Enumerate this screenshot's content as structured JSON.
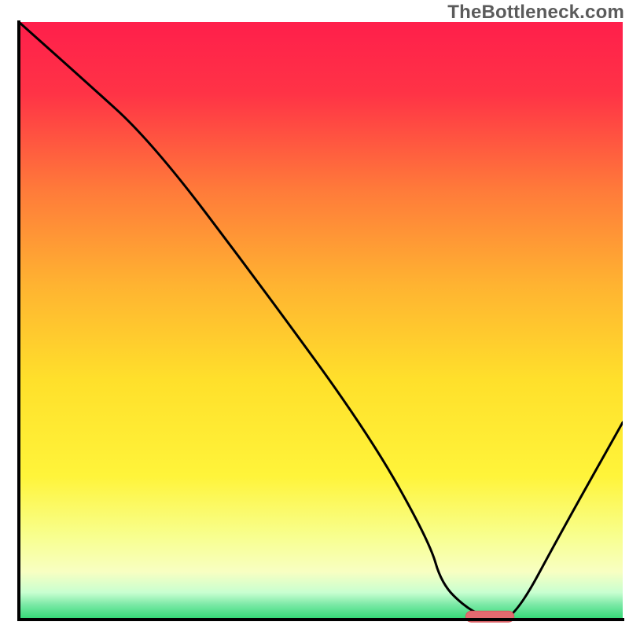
{
  "watermark": {
    "text": "TheBottleneck.com"
  },
  "colors": {
    "axis": "#000000",
    "curve": "#000000",
    "marker_fill": "#e46a6f",
    "marker_stroke": "#d85a60"
  },
  "chart_data": {
    "type": "line",
    "title": "",
    "xlabel": "",
    "ylabel": "",
    "xlim": [
      0,
      100
    ],
    "ylim": [
      0,
      100
    ],
    "grid": false,
    "legend": false,
    "background_gradient": {
      "direction": "vertical",
      "stops": [
        {
          "pos": 0.0,
          "color": "#ff1f4b"
        },
        {
          "pos": 0.12,
          "color": "#ff3346"
        },
        {
          "pos": 0.28,
          "color": "#ff7a3a"
        },
        {
          "pos": 0.44,
          "color": "#ffb331"
        },
        {
          "pos": 0.6,
          "color": "#ffe02b"
        },
        {
          "pos": 0.76,
          "color": "#fff43a"
        },
        {
          "pos": 0.86,
          "color": "#f8ff8e"
        },
        {
          "pos": 0.92,
          "color": "#f8ffc2"
        },
        {
          "pos": 0.955,
          "color": "#c8ffd0"
        },
        {
          "pos": 0.975,
          "color": "#7be9a6"
        },
        {
          "pos": 1.0,
          "color": "#2fd873"
        }
      ]
    },
    "series": [
      {
        "name": "bottleneck-curve",
        "x": [
          0,
          10,
          22,
          40,
          58,
          68,
          70,
          74,
          78,
          82,
          90,
          100
        ],
        "y": [
          100,
          91,
          80,
          56,
          31,
          13,
          6,
          2,
          0,
          0,
          15,
          33
        ]
      }
    ],
    "marker": {
      "name": "optimal-range",
      "x_start": 74,
      "x_end": 82,
      "y": 0.5
    }
  }
}
